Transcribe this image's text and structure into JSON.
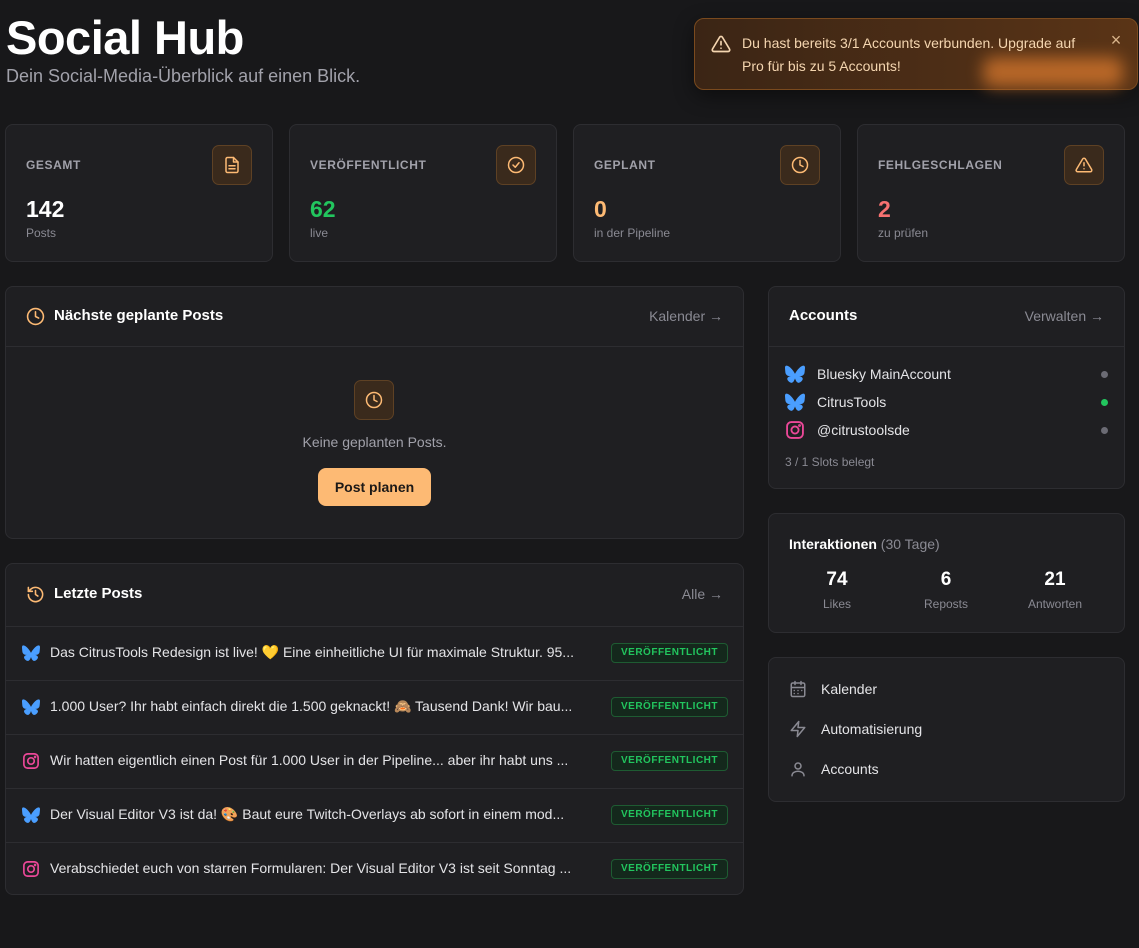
{
  "header": {
    "title": "Social Hub",
    "subtitle": "Dein Social-Media-Überblick auf einen Blick."
  },
  "toast": {
    "message": "Du hast bereits 3/1 Accounts verbunden. Upgrade auf Pro für bis zu 5 Accounts!",
    "close": "×",
    "icon": "warning-icon"
  },
  "stats": [
    {
      "label": "GESAMT",
      "value": "142",
      "sub": "Posts",
      "icon": "document-icon",
      "color": "#ffffff"
    },
    {
      "label": "VERÖFFENTLICHT",
      "value": "62",
      "sub": "live",
      "icon": "check-circle-icon",
      "color": "#22c55e"
    },
    {
      "label": "GEPLANT",
      "value": "0",
      "sub": "in der Pipeline",
      "icon": "clock-icon",
      "color": "#fdba74"
    },
    {
      "label": "FEHLGESCHLAGEN",
      "value": "2",
      "sub": "zu prüfen",
      "icon": "warning-icon",
      "color": "#f87171"
    }
  ],
  "scheduled": {
    "title": "Nächste geplante Posts",
    "link": "Kalender →",
    "empty_text": "Keine geplanten Posts.",
    "button": "Post planen"
  },
  "recent": {
    "title": "Letzte Posts",
    "link": "Alle →",
    "posts": [
      {
        "platform": "bluesky",
        "text": "Das CitrusTools Redesign ist live! 💛 Eine einheitliche UI für maximale Struktur. 95...",
        "status": "VERÖFFENTLICHT"
      },
      {
        "platform": "bluesky",
        "text": "1.000 User? Ihr habt einfach direkt die 1.500 geknackt! 🙈 Tausend Dank! Wir bau...",
        "status": "VERÖFFENTLICHT"
      },
      {
        "platform": "instagram",
        "text": "Wir hatten eigentlich einen Post für 1.000 User in der Pipeline... aber ihr habt uns ...",
        "status": "VERÖFFENTLICHT"
      },
      {
        "platform": "bluesky",
        "text": "Der Visual Editor V3 ist da! 🎨 Baut eure Twitch-Overlays ab sofort in einem mod...",
        "status": "VERÖFFENTLICHT"
      },
      {
        "platform": "instagram",
        "text": "Verabschiedet euch von starren Formularen: Der Visual Editor V3 ist seit Sonntag ...",
        "status": "VERÖFFENTLICHT"
      }
    ]
  },
  "accounts": {
    "title": "Accounts",
    "link": "Verwalten →",
    "items": [
      {
        "platform": "bluesky",
        "name": "Bluesky MainAccount",
        "status_color": "#6b6b74"
      },
      {
        "platform": "bluesky",
        "name": "CitrusTools",
        "status_color": "#22c55e"
      },
      {
        "platform": "instagram",
        "name": "@citrustoolsde",
        "status_color": "#6b6b74"
      }
    ],
    "footer": "3 / 1 Slots belegt"
  },
  "interactions": {
    "title": "Interaktionen",
    "period": "(30 Tage)",
    "items": [
      {
        "value": "74",
        "label": "Likes"
      },
      {
        "value": "6",
        "label": "Reposts"
      },
      {
        "value": "21",
        "label": "Antworten"
      }
    ]
  },
  "quicknav": [
    {
      "label": "Kalender",
      "icon": "calendar-icon"
    },
    {
      "label": "Automatisierung",
      "icon": "lightning-icon"
    },
    {
      "label": "Accounts",
      "icon": "user-icon"
    }
  ],
  "colors": {
    "accent": "#fdba74",
    "bluesky": "#4a9eff",
    "instagram": "#ec4899",
    "success": "#22c55e",
    "danger": "#f87171"
  }
}
